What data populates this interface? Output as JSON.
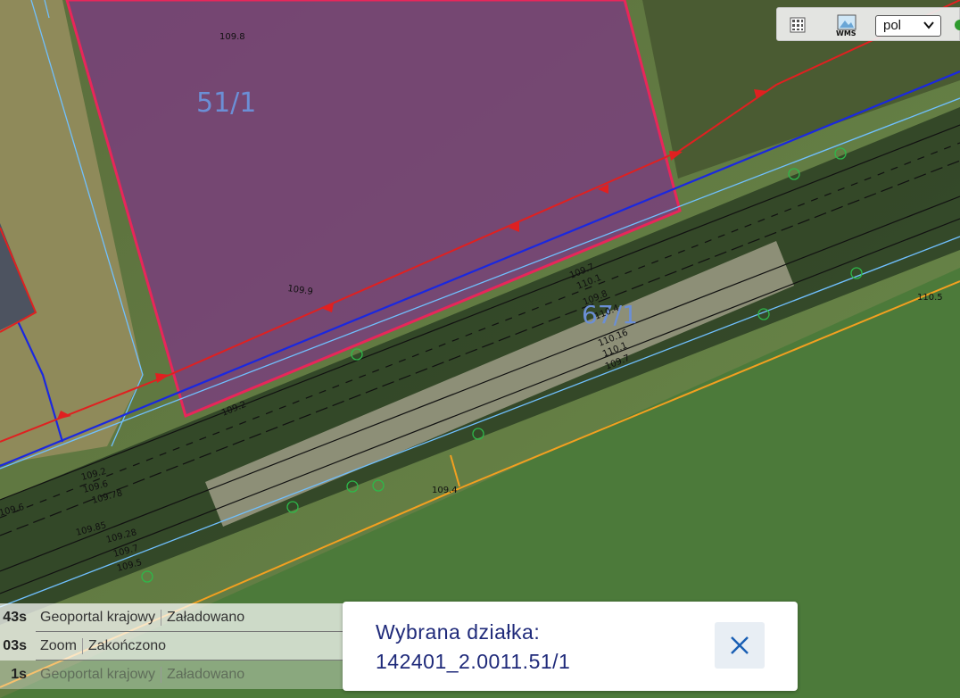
{
  "map": {
    "parcels": [
      {
        "label": "51/1",
        "color": "#6b8fd6"
      },
      {
        "label": "67/1",
        "color": "#6b8fd6"
      }
    ],
    "elevations": [
      "109.8",
      "109.9",
      "109.2",
      "109.7",
      "110.1",
      "109.8",
      "110.4",
      "110.16",
      "110.1",
      "109.7",
      "109.2",
      "109.6",
      "109.78",
      "109.85",
      "109.28",
      "109.7",
      "109.5",
      "109.6",
      "110.5",
      "109.4"
    ],
    "colors": {
      "selection_fill": "#7a3d7e",
      "selection_border": "#e8265a",
      "red_line": "#e02020",
      "blue_line": "#1a28e0",
      "orange_line": "#f3a020",
      "cyan_line": "#70c0ff"
    }
  },
  "toolbar": {
    "legend_icon": "legend-grid-icon",
    "wms_icon": "wms-map-icon",
    "wms_label": "WMS",
    "language_value": "pol"
  },
  "log": [
    {
      "time": "43s",
      "name": "Geoportal krajowy",
      "status": "Załadowano"
    },
    {
      "time": "03s",
      "name": "Zoom",
      "status": "Zakończono"
    },
    {
      "time": "1s",
      "name": "Geoportal krajowy",
      "status": "Załadowano"
    }
  ],
  "popup": {
    "title": "Wybrana działka:",
    "parcel_id": "142401_2.0011.51/1",
    "close_icon": "close-icon"
  }
}
